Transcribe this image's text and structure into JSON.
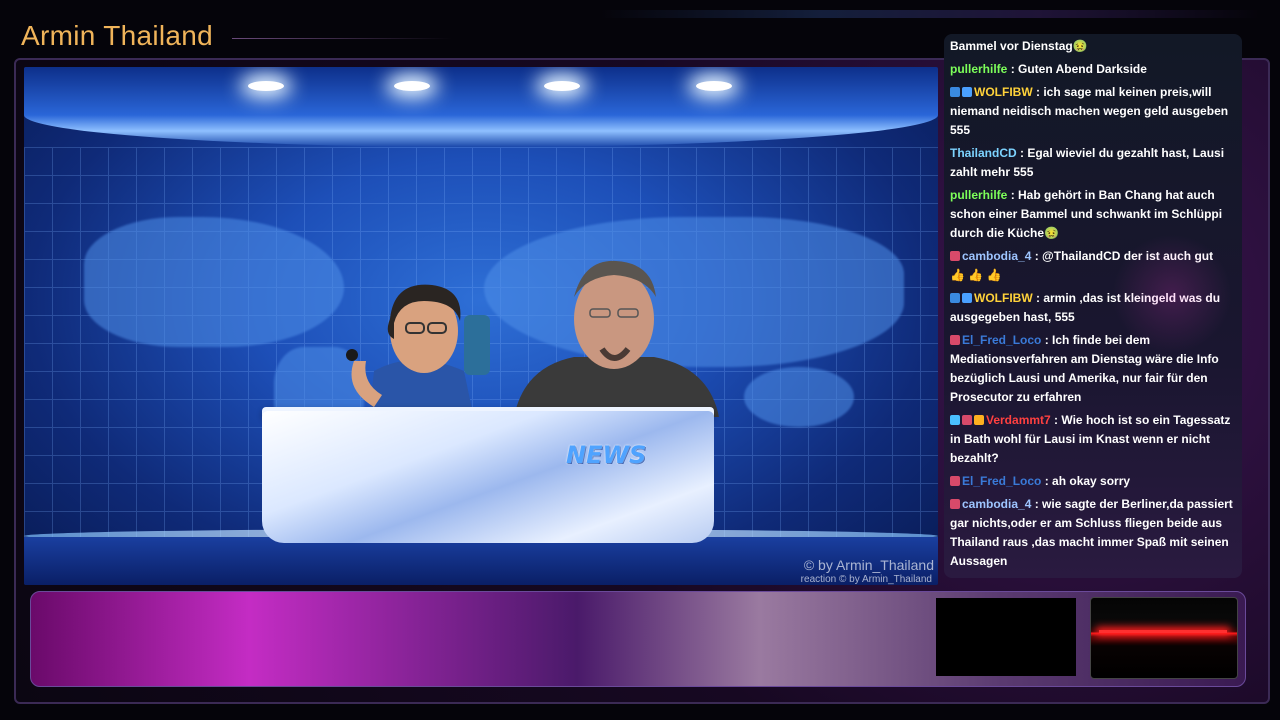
{
  "channel": {
    "title": "Armin Thailand"
  },
  "video": {
    "desk_label": "NEWS",
    "watermark": "© by Armin_Thailand",
    "reaction_watermark": "reaction  © by Armin_Thailand"
  },
  "chat": {
    "messages": [
      {
        "user": "",
        "text": "Bammel vor Dienstag",
        "emoji": "🤢"
      },
      {
        "user": "pullerhilfe",
        "user_color": "#7dff5a",
        "text": ": Guten Abend Darkside"
      },
      {
        "user": "WOLFIBW",
        "user_color": "#ffd23a",
        "badges": [
          "#3a8ae0",
          "#4aa0ff"
        ],
        "text": ": ich sage mal keinen preis,will niemand neidisch machen wegen geld ausgeben 555"
      },
      {
        "user": "ThailandCD",
        "user_color": "#7dd3ff",
        "text": ": Egal wieviel du gezahlt hast, Lausi zahlt mehr 555"
      },
      {
        "user": "pullerhilfe",
        "user_color": "#7dff5a",
        "text": ": Hab gehört in Ban Chang hat auch schon einer Bammel und schwankt im Schlüppi durch die Küche",
        "emoji": "🤢"
      },
      {
        "user": "cambodia_4",
        "user_color": "#9ec5ff",
        "badges": [
          "#d84a6a"
        ],
        "text": ": @ThailandCD der ist auch gut",
        "emoji": "👍 👍 👍"
      },
      {
        "user": "WOLFIBW",
        "user_color": "#ffd23a",
        "badges": [
          "#3a8ae0",
          "#4aa0ff"
        ],
        "text": ": armin ,das ist kleingeld was du ausgegeben hast, 555"
      },
      {
        "user": "El_Fred_Loco",
        "user_color": "#3a7ad8",
        "badges": [
          "#d84a6a"
        ],
        "text": ": Ich finde bei dem Mediationsverfahren am Dienstag wäre die Info bezüglich Lausi und Amerika, nur fair für den Prosecutor zu erfahren"
      },
      {
        "user": "Verdammt7",
        "user_color": "#ff4040",
        "badges": [
          "#4ac0ff",
          "#d84a6a",
          "#ffb020"
        ],
        "text": ": Wie hoch ist so ein Tagessatz in Bath wohl für Lausi im Knast wenn er nicht bezahlt?"
      },
      {
        "user": "El_Fred_Loco",
        "user_color": "#3a7ad8",
        "badges": [
          "#d84a6a"
        ],
        "text": ": ah okay sorry"
      },
      {
        "user": "cambodia_4",
        "user_color": "#9ec5ff",
        "badges": [
          "#d84a6a"
        ],
        "text": ": wie sagte der Berliner,da passiert gar nichts,oder er am Schluss fliegen beide aus Thailand raus ,das macht immer Spaß mit seinen Aussagen"
      }
    ]
  }
}
